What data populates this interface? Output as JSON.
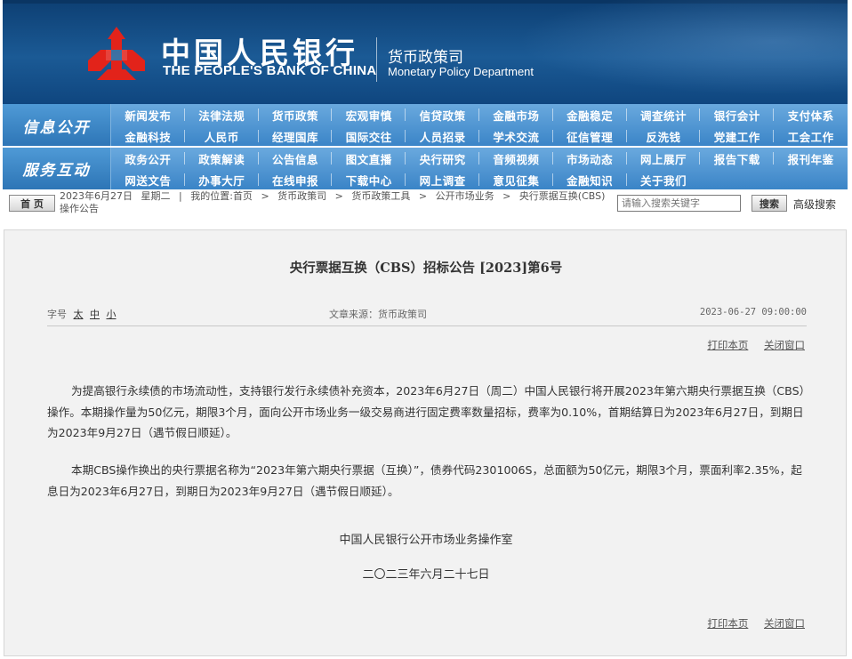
{
  "header": {
    "bank_cn": "中国人民银行",
    "bank_en": "THE PEOPLE'S BANK OF CHINA",
    "dept_cn": "货币政策司",
    "dept_en": "Monetary Policy Department",
    "logo_color": "#e2231a"
  },
  "nav": {
    "sections": [
      {
        "label": "信息公开",
        "rows": [
          [
            "新闻发布",
            "法律法规",
            "货币政策",
            "宏观审慎",
            "信贷政策",
            "金融市场",
            "金融稳定",
            "调查统计",
            "银行会计",
            "支付体系"
          ],
          [
            "金融科技",
            "人民币",
            "经理国库",
            "国际交往",
            "人员招录",
            "学术交流",
            "征信管理",
            "反洗钱",
            "党建工作",
            "工会工作"
          ]
        ]
      },
      {
        "label": "服务互动",
        "rows": [
          [
            "政务公开",
            "政策解读",
            "公告信息",
            "图文直播",
            "央行研究",
            "音频视频",
            "市场动态",
            "网上展厅",
            "报告下载",
            "报刊年鉴"
          ],
          [
            "网送文告",
            "办事大厅",
            "在线申报",
            "下载中心",
            "网上调查",
            "意见征集",
            "金融知识",
            "关于我们"
          ]
        ]
      }
    ]
  },
  "crumb": {
    "home": "首 页",
    "date": "2023年6月27日",
    "weekday": "星期二",
    "location_label": "我的位置:",
    "path": [
      "首页",
      "货币政策司",
      "货币政策工具",
      "公开市场业务",
      "央行票据互换(CBS)操作公告"
    ]
  },
  "search": {
    "placeholder": "请输入搜索关键字",
    "button": "搜索",
    "advanced": "高级搜索"
  },
  "article": {
    "title": "央行票据互换（CBS）招标公告 [2023]第6号",
    "font_size_label": "字号",
    "font_sizes": [
      "太",
      "中",
      "小"
    ],
    "source": "文章来源：货币政策司",
    "datetime": "2023-06-27 09:00:00",
    "print": "打印本页",
    "close": "关闭窗口",
    "para1": "为提高银行永续债的市场流动性，支持银行发行永续债补充资本，2023年6月27日（周二）中国人民银行将开展2023年第六期央行票据互换（CBS）操作。本期操作量为50亿元，期限3个月，面向公开市场业务一级交易商进行固定费率数量招标，费率为0.10%，首期结算日为2023年6月27日，到期日为2023年9月27日（遇节假日顺延）。",
    "para2": "本期CBS操作换出的央行票据名称为“2023年第六期央行票据（互换）”，债券代码2301006S，总面额为50亿元，期限3个月，票面利率2.35%，起息日为2023年6月27日，到期日为2023年9月27日（遇节假日顺延）。",
    "sign_org": "中国人民银行公开市场业务操作室",
    "sign_date": "二〇二三年六月二十七日"
  }
}
